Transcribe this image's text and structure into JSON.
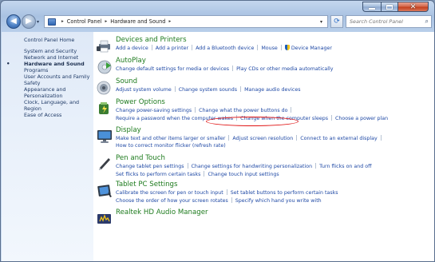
{
  "colors": {
    "title_green": "#1e7b1e",
    "link_blue": "#1f49a5",
    "highlight_circle": "#e01414"
  },
  "window": {
    "caption": {
      "min_icon": "minimize-icon",
      "max_icon": "maximize-icon",
      "close_icon": "close-icon",
      "close_glyph": "✕"
    }
  },
  "nav": {
    "back_glyph": "◀",
    "forward_glyph": "▶",
    "dropdown_glyph": "▾",
    "address": {
      "sep": "▸",
      "crumbs": [
        "Control Panel",
        "Hardware and Sound"
      ],
      "trail_sep": "▸",
      "dropdown_glyph": "▾"
    },
    "refresh_glyph": "⟳",
    "search": {
      "placeholder": "Search Control Panel",
      "icon_glyph": "⌕"
    }
  },
  "sidebar": {
    "home": "Control Panel Home",
    "bullet": "•",
    "items": [
      "System and Security",
      "Network and Internet",
      "Hardware and Sound",
      "Programs",
      "User Accounts and Family Safety",
      "Appearance and Personalization",
      "Clock, Language, and Region",
      "Ease of Access"
    ]
  },
  "categories": {
    "devices": {
      "title": "Devices and Printers",
      "links": [
        "Add a device",
        "Add a printer",
        "Add a Bluetooth device",
        "Mouse",
        "Device Manager"
      ]
    },
    "autoplay": {
      "title": "AutoPlay",
      "links": [
        "Change default settings for media or devices",
        "Play CDs or other media automatically"
      ]
    },
    "sound": {
      "title": "Sound",
      "links": [
        "Adjust system volume",
        "Change system sounds",
        "Manage audio devices"
      ]
    },
    "power": {
      "title": "Power Options",
      "links_row1": [
        "Change power-saving settings",
        "Change what the power buttons do"
      ],
      "links_row2": [
        "Require a password when the computer wakes",
        "Change when the computer sleeps",
        "Choose a power plan"
      ]
    },
    "display": {
      "title": "Display",
      "links_row1": [
        "Make text and other items larger or smaller",
        "Adjust screen resolution",
        "Connect to an external display"
      ],
      "links_row2": [
        "How to correct monitor flicker (refresh rate)"
      ]
    },
    "pen": {
      "title": "Pen and Touch",
      "links_row1": [
        "Change tablet pen settings",
        "Change settings for handwriting personalization",
        "Turn flicks on and off"
      ],
      "links_row2": [
        "Set flicks to perform certain tasks",
        "Change touch input settings"
      ]
    },
    "tablet": {
      "title": "Tablet PC Settings",
      "links_row1": [
        "Calibrate the screen for pen or touch input",
        "Set tablet buttons to perform certain tasks"
      ],
      "links_row2": [
        "Choose the order of how your screen rotates",
        "Specify which hand you write with"
      ]
    },
    "realtek": {
      "title": "Realtek HD Audio Manager"
    }
  }
}
